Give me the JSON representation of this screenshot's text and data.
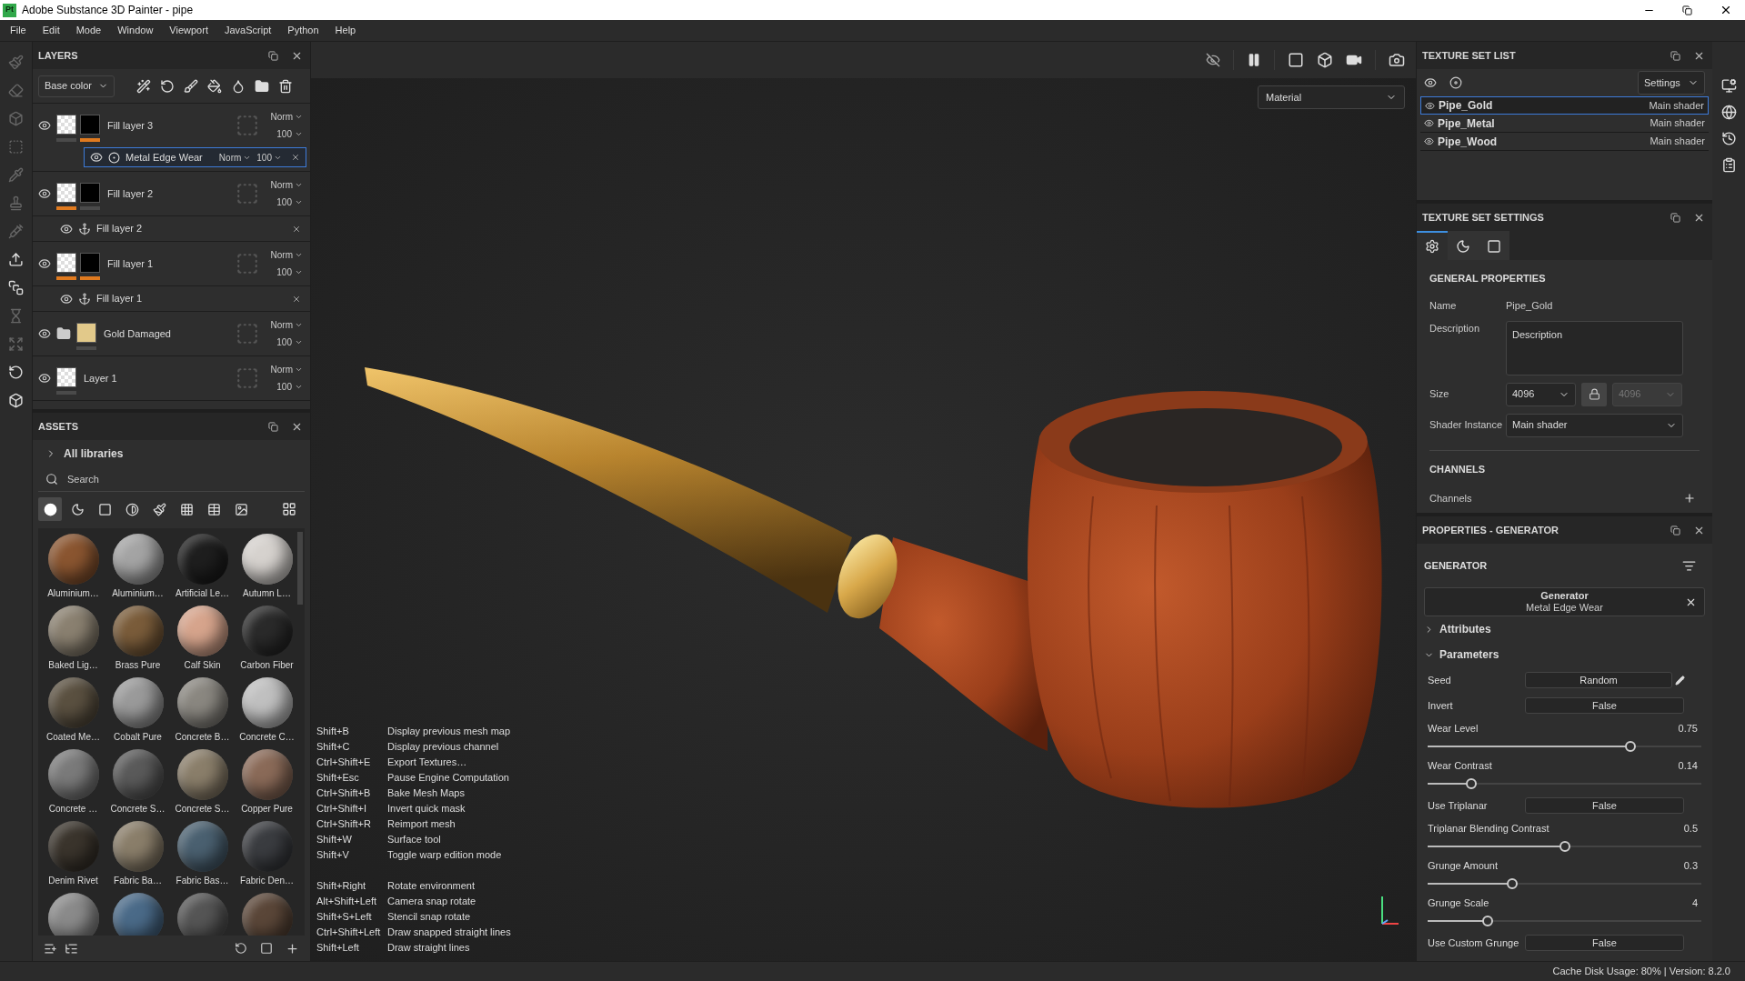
{
  "window": {
    "app_icon": "Pt",
    "title": "Adobe Substance 3D Painter - pipe"
  },
  "menu": [
    "File",
    "Edit",
    "Mode",
    "Window",
    "Viewport",
    "JavaScript",
    "Python",
    "Help"
  ],
  "layers_panel": {
    "title": "LAYERS",
    "channel": "Base color",
    "layers": [
      {
        "kind": "fill",
        "name": "Fill layer 3",
        "visible": true,
        "selected": false,
        "blend": "Norm",
        "opacity": "100",
        "thumbs": [
          {
            "kind": "checker",
            "accent": false
          },
          {
            "kind": "black",
            "accent": true
          }
        ],
        "effects": [
          {
            "kind": "generator",
            "name": "Metal Edge Wear",
            "visible": true,
            "selected": true,
            "blend": "Norm",
            "opacity": "100"
          }
        ]
      },
      {
        "kind": "fill",
        "name": "Fill layer 2",
        "visible": true,
        "selected": false,
        "blend": "Norm",
        "opacity": "100",
        "thumbs": [
          {
            "kind": "checker",
            "accent": true
          },
          {
            "kind": "black",
            "accent": false
          }
        ],
        "effects": [
          {
            "kind": "anchor",
            "name": "Fill layer 2",
            "visible": true,
            "selected": false
          }
        ]
      },
      {
        "kind": "fill",
        "name": "Fill layer 1",
        "visible": true,
        "selected": false,
        "blend": "Norm",
        "opacity": "100",
        "thumbs": [
          {
            "kind": "checker",
            "accent": true
          },
          {
            "kind": "black",
            "accent": true
          }
        ],
        "effects": [
          {
            "kind": "anchor",
            "name": "Fill layer 1",
            "visible": true,
            "selected": false
          }
        ]
      },
      {
        "kind": "folder",
        "name": "Gold Damaged",
        "visible": true,
        "selected": false,
        "blend": "Norm",
        "opacity": "100",
        "thumbs": [
          {
            "kind": "gold",
            "accent": false
          }
        ]
      },
      {
        "kind": "paint",
        "name": "Layer 1",
        "visible": true,
        "selected": false,
        "blend": "Norm",
        "opacity": "100",
        "thumbs": [
          {
            "kind": "checker",
            "accent": false
          }
        ]
      }
    ]
  },
  "assets_panel": {
    "title": "ASSETS",
    "library": "All libraries",
    "search": {
      "placeholder": "Search"
    },
    "filters": [
      {
        "selected": true
      },
      {
        "selected": false
      },
      {
        "selected": false
      },
      {
        "selected": false
      },
      {
        "selected": false
      },
      {
        "selected": false
      },
      {
        "selected": false
      },
      {
        "selected": false
      },
      {
        "selected": false
      }
    ],
    "items": [
      {
        "name": "Aluminium…",
        "color": "#8a5530"
      },
      {
        "name": "Aluminium…",
        "color": "#a4a4a4"
      },
      {
        "name": "Artificial Le…",
        "color": "#1e1e1e"
      },
      {
        "name": "Autumn L…",
        "color": "#d6d2ce"
      },
      {
        "name": "Baked Lig…",
        "color": "#8a8070"
      },
      {
        "name": "Brass Pure",
        "color": "#7a5c3a"
      },
      {
        "name": "Calf Skin",
        "color": "#d6a48c"
      },
      {
        "name": "Carbon Fiber",
        "color": "#2a2a2a"
      },
      {
        "name": "Coated Me…",
        "color": "#5a5040"
      },
      {
        "name": "Cobalt Pure",
        "color": "#9a9a9a"
      },
      {
        "name": "Concrete B…",
        "color": "#8a8780"
      },
      {
        "name": "Concrete C…",
        "color": "#c0c0c0"
      },
      {
        "name": "Concrete …",
        "color": "#7a7a7a"
      },
      {
        "name": "Concrete S…",
        "color": "#5a5a5a"
      },
      {
        "name": "Concrete S…",
        "color": "#8a7e6a"
      },
      {
        "name": "Copper Pure",
        "color": "#8a6a58"
      },
      {
        "name": "Denim Rivet",
        "color": "#3a342c"
      },
      {
        "name": "Fabric Ba…",
        "color": "#8a7e6a"
      },
      {
        "name": "Fabric Bas…",
        "color": "#4a6070"
      },
      {
        "name": "Fabric Den…",
        "color": "#3a3c40"
      },
      {
        "color": "#8a8a8a"
      },
      {
        "color": "#4a6a88"
      },
      {
        "color": "#555555"
      },
      {
        "color": "#5a4638"
      }
    ]
  },
  "viewport": {
    "mode": "Material",
    "shortcut_groups": [
      [
        {
          "keys": "Shift+B",
          "action": "Display previous mesh map"
        },
        {
          "keys": "Shift+C",
          "action": "Display previous channel"
        },
        {
          "keys": "Ctrl+Shift+E",
          "action": "Export Textures…"
        },
        {
          "keys": "Shift+Esc",
          "action": "Pause Engine Computation"
        },
        {
          "keys": "Ctrl+Shift+B",
          "action": "Bake Mesh Maps"
        },
        {
          "keys": "Ctrl+Shift+I",
          "action": "Invert quick mask"
        },
        {
          "keys": "Ctrl+Shift+R",
          "action": "Reimport mesh"
        },
        {
          "keys": "Shift+W",
          "action": "Surface tool"
        },
        {
          "keys": "Shift+V",
          "action": "Toggle warp edition mode"
        }
      ],
      [
        {
          "keys": "Shift+Right",
          "action": "Rotate environment"
        },
        {
          "keys": "Alt+Shift+Left",
          "action": "Camera snap rotate"
        },
        {
          "keys": "Shift+S+Left",
          "action": "Stencil snap rotate"
        },
        {
          "keys": "Ctrl+Shift+Left",
          "action": "Draw snapped straight lines"
        },
        {
          "keys": "Shift+Left",
          "action": "Draw straight lines"
        }
      ]
    ]
  },
  "texture_set_list": {
    "title": "TEXTURE SET LIST",
    "filter": "Settings",
    "sets": [
      {
        "name": "Pipe_Gold",
        "shader": "Main shader",
        "visible": true,
        "selected": true
      },
      {
        "name": "Pipe_Metal",
        "shader": "Main shader",
        "visible": true,
        "selected": false
      },
      {
        "name": "Pipe_Wood",
        "shader": "Main shader",
        "visible": true,
        "selected": false
      }
    ]
  },
  "texture_set_settings": {
    "title": "TEXTURE SET SETTINGS",
    "tabs": [
      {
        "selected": true
      },
      {
        "selected": false
      },
      {
        "selected": false
      }
    ],
    "section": "GENERAL PROPERTIES",
    "name": {
      "label": "Name",
      "value": "Pipe_Gold"
    },
    "description": {
      "label": "Description",
      "value": "Description"
    },
    "size": {
      "label": "Size",
      "value": "4096",
      "linked_value": "4096",
      "linked_disabled": true
    },
    "shader_instance": {
      "label": "Shader Instance",
      "value": "Main shader"
    },
    "channels_section": "CHANNELS",
    "channels_label": "Channels"
  },
  "properties": {
    "title": "PROPERTIES - GENERATOR",
    "section": "GENERATOR",
    "generator": {
      "title": "Generator",
      "name": "Metal Edge Wear"
    },
    "groups": [
      {
        "label": "Attributes",
        "expanded": false
      },
      {
        "label": "Parameters",
        "expanded": true
      }
    ],
    "parameters": [
      {
        "kind": "button",
        "label": "Seed",
        "value": "Random"
      },
      {
        "kind": "toggle",
        "label": "Invert",
        "value": "False"
      },
      {
        "kind": "slider",
        "label": "Wear Level",
        "reading": "0.75",
        "level": 0.74
      },
      {
        "kind": "slider",
        "label": "Wear Contrast",
        "reading": "0.14",
        "level": 0.16
      },
      {
        "kind": "toggle",
        "label": "Use Triplanar",
        "value": "False"
      },
      {
        "kind": "slider",
        "label": "Triplanar Blending Contrast",
        "reading": "0.5",
        "level": 0.5
      },
      {
        "kind": "slider",
        "label": "Grunge Amount",
        "reading": "0.3",
        "level": 0.31
      },
      {
        "kind": "slider",
        "label": "Grunge Scale",
        "reading": "4",
        "level": 0.22
      },
      {
        "kind": "toggle",
        "label": "Use Custom Grunge",
        "value": "False"
      }
    ]
  },
  "status_bar": "Cache Disk Usage: 80% | Version: 8.2.0"
}
